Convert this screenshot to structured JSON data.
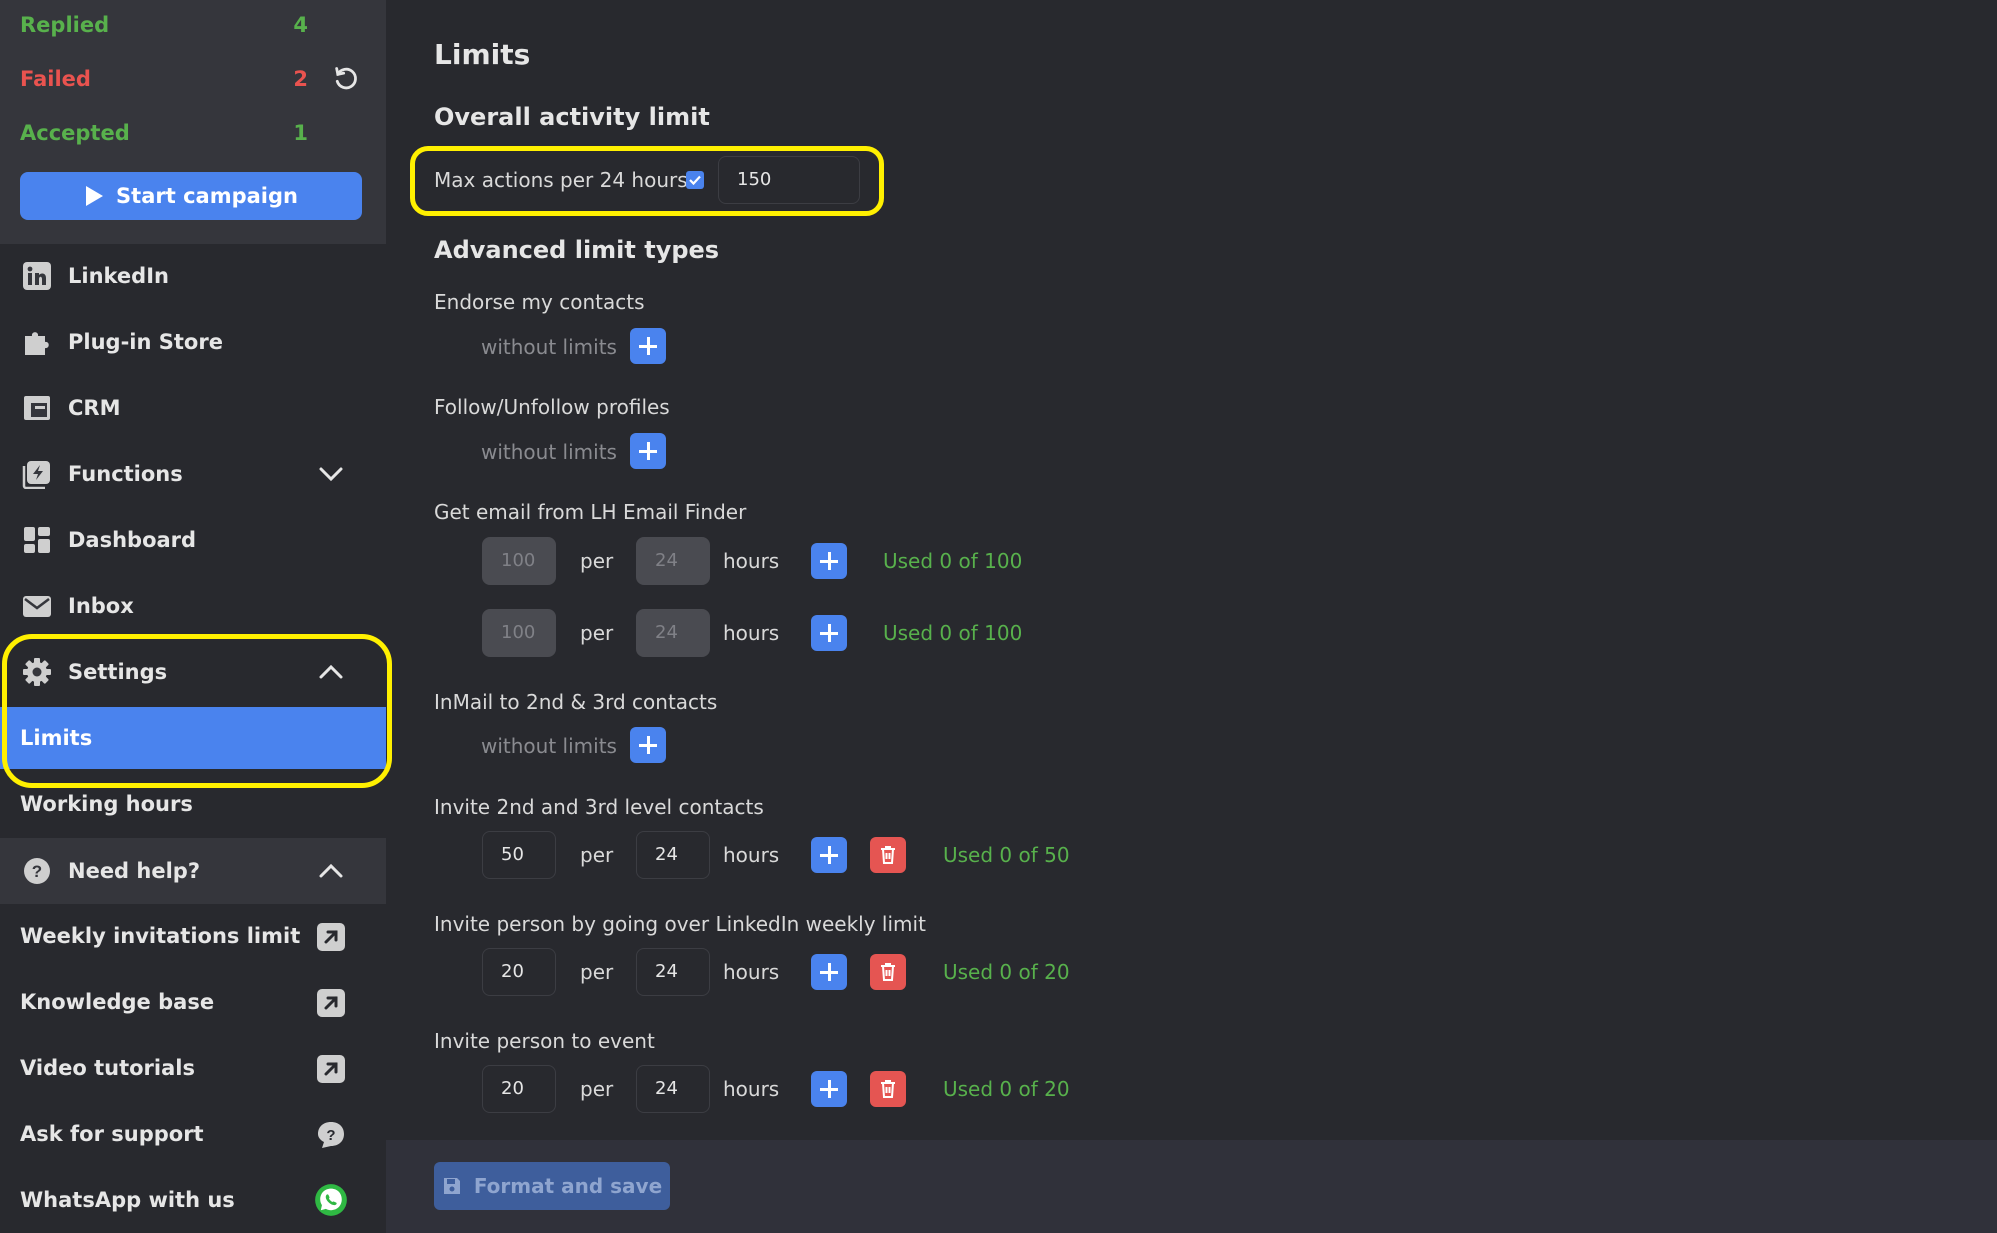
{
  "sidebar": {
    "stats": [
      {
        "label": "Replied",
        "count": "4"
      },
      {
        "label": "Failed",
        "count": "2"
      },
      {
        "label": "Accepted",
        "count": "1"
      }
    ],
    "start_campaign": "Start campaign",
    "nav": [
      {
        "label": "LinkedIn",
        "icon": "linkedin-icon"
      },
      {
        "label": "Plug-in Store",
        "icon": "puzzle-icon"
      },
      {
        "label": "CRM",
        "icon": "crm-icon"
      },
      {
        "label": "Functions",
        "icon": "functions-icon"
      },
      {
        "label": "Dashboard",
        "icon": "dashboard-icon"
      },
      {
        "label": "Inbox",
        "icon": "mail-icon"
      },
      {
        "label": "Settings",
        "icon": "gear-icon"
      }
    ],
    "settings_sub": [
      {
        "label": "Limits",
        "active": true
      },
      {
        "label": "Working hours",
        "active": false
      }
    ],
    "need_help": "Need help?",
    "help_items": [
      {
        "label": "Weekly invitations limit",
        "icon": "external-link-icon"
      },
      {
        "label": "Knowledge base",
        "icon": "external-link-icon"
      },
      {
        "label": "Video tutorials",
        "icon": "external-link-icon"
      },
      {
        "label": "Ask for support",
        "icon": "question-icon"
      },
      {
        "label": "WhatsApp with us",
        "icon": "whatsapp-icon"
      }
    ]
  },
  "main": {
    "title": "Limits",
    "overall_title": "Overall activity limit",
    "max_actions_label": "Max actions per 24 hours",
    "max_actions_checked": true,
    "max_actions_value": "150",
    "advanced_title": "Advanced limit types",
    "per_word": "per",
    "hours_word": "hours",
    "without_limits": "without limits",
    "limits": [
      {
        "label": "Endorse my contacts"
      },
      {
        "label": "Follow/Unfollow profiles"
      },
      {
        "label": "Get email from LH Email Finder",
        "rows": [
          {
            "count": "100",
            "hours": "24",
            "used": "Used 0 of 100"
          },
          {
            "count": "100",
            "hours": "24",
            "used": "Used 0 of 100"
          }
        ]
      },
      {
        "label": "InMail to 2nd & 3rd contacts"
      },
      {
        "label": "Invite 2nd and 3rd level contacts",
        "rows": [
          {
            "count": "50",
            "hours": "24",
            "used": "Used 0 of 50"
          }
        ]
      },
      {
        "label": "Invite person by going over LinkedIn weekly limit",
        "rows": [
          {
            "count": "20",
            "hours": "24",
            "used": "Used 0 of 20"
          }
        ]
      },
      {
        "label": "Invite person to event",
        "rows": [
          {
            "count": "20",
            "hours": "24",
            "used": "Used 0 of 20"
          }
        ]
      }
    ],
    "save_button": "Format and save"
  },
  "colors": {
    "accent": "#4a83ee",
    "success": "#58b14c",
    "danger": "#e9534f",
    "highlight": "#fff000"
  }
}
